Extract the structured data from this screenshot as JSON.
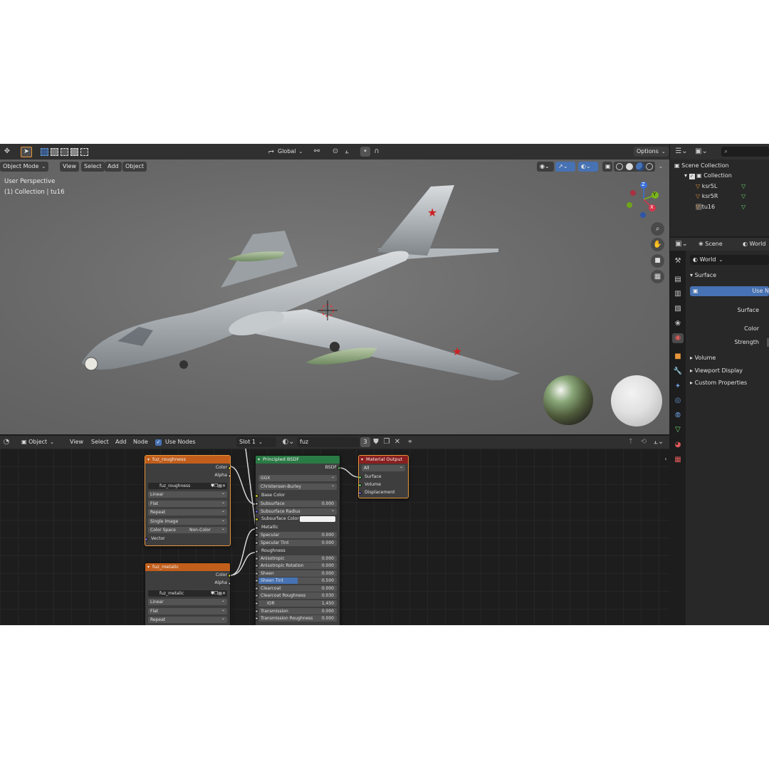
{
  "viewport_header": {
    "mode": "Object Mode",
    "menus": [
      "View",
      "Select",
      "Add",
      "Object"
    ],
    "transform_orientation": "Global",
    "options": "Options",
    "view_name": "User Perspective",
    "collection_info": "(1) Collection | tu16"
  },
  "gizmo": {
    "z": "Z",
    "y": "Y",
    "x": "X"
  },
  "node_header": {
    "editor_type": "Object",
    "menus": [
      "View",
      "Select",
      "Add",
      "Node"
    ],
    "use_nodes_label": "Use Nodes",
    "use_nodes_checked": true,
    "slot": "Slot 1",
    "material": "fuz",
    "user_count": "3"
  },
  "nodes": {
    "roughness": {
      "title": "fuz_roughness",
      "outputs": [
        "Color",
        "Alpha"
      ],
      "image": "fuz_roughness",
      "interpolation": "Linear",
      "projection": "Flat",
      "extension": "Repeat",
      "source": "Single Image",
      "color_space_label": "Color Space",
      "color_space": "Non-Color",
      "input": "Vector"
    },
    "metallic": {
      "title": "fuz_metalic",
      "outputs": [
        "Color",
        "Alpha"
      ],
      "image": "fuz_metalic",
      "interpolation": "Linear",
      "projection": "Flat",
      "extension": "Repeat"
    },
    "bsdf": {
      "title": "Principled BSDF",
      "output": "BSDF",
      "distribution": "GGX",
      "subsurface_method": "Christensen-Burley",
      "base_color": "Base Color",
      "subsurface": {
        "label": "Subsurface",
        "value": "0.000"
      },
      "subsurface_radius": "Subsurface Radius",
      "subsurface_color": "Subsurface Color",
      "metallic": "Metallic",
      "specular": {
        "label": "Specular",
        "value": "0.000"
      },
      "specular_tint": {
        "label": "Specular Tint",
        "value": "0.000"
      },
      "roughness": "Roughness",
      "anisotropic": {
        "label": "Anisotropic",
        "value": "0.000"
      },
      "anisotropic_rotation": {
        "label": "Anisotropic Rotation",
        "value": "0.000"
      },
      "sheen": {
        "label": "Sheen",
        "value": "0.000"
      },
      "sheen_tint": {
        "label": "Sheen Tint",
        "value": "0.500",
        "fill": 0.5
      },
      "clearcoat": {
        "label": "Clearcoat",
        "value": "0.000"
      },
      "clearcoat_roughness": {
        "label": "Clearcoat Roughness",
        "value": "0.030"
      },
      "ior": {
        "label": "IOR",
        "value": "1.450"
      },
      "transmission": {
        "label": "Transmission",
        "value": "0.000"
      },
      "transmission_roughness": {
        "label": "Transmission Roughness",
        "value": "0.000"
      }
    },
    "output": {
      "title": "Material Output",
      "target": "All",
      "inputs": [
        "Surface",
        "Volume",
        "Displacement"
      ]
    }
  },
  "outliner": {
    "root": "Scene Collection",
    "collection": "Collection",
    "objects": [
      "ksr5L",
      "ksr5R",
      "tu16"
    ]
  },
  "properties": {
    "scene_tab": "Scene",
    "world_tab": "World",
    "world_name": "World",
    "surface_panel": "Surface",
    "use_nodes_button": "Use N",
    "surface_label": "Surface",
    "color_label": "Color",
    "strength_label": "Strength",
    "collapsed_panels": [
      "Volume",
      "Viewport Display",
      "Custom Properties"
    ]
  },
  "colors": {
    "node_texture_header": "#c25e1b",
    "node_shader_header": "#2a7a45",
    "node_output_header": "#8a1f1f",
    "selection_blue": "#4772b3",
    "accent_orange": "#e8963a"
  }
}
